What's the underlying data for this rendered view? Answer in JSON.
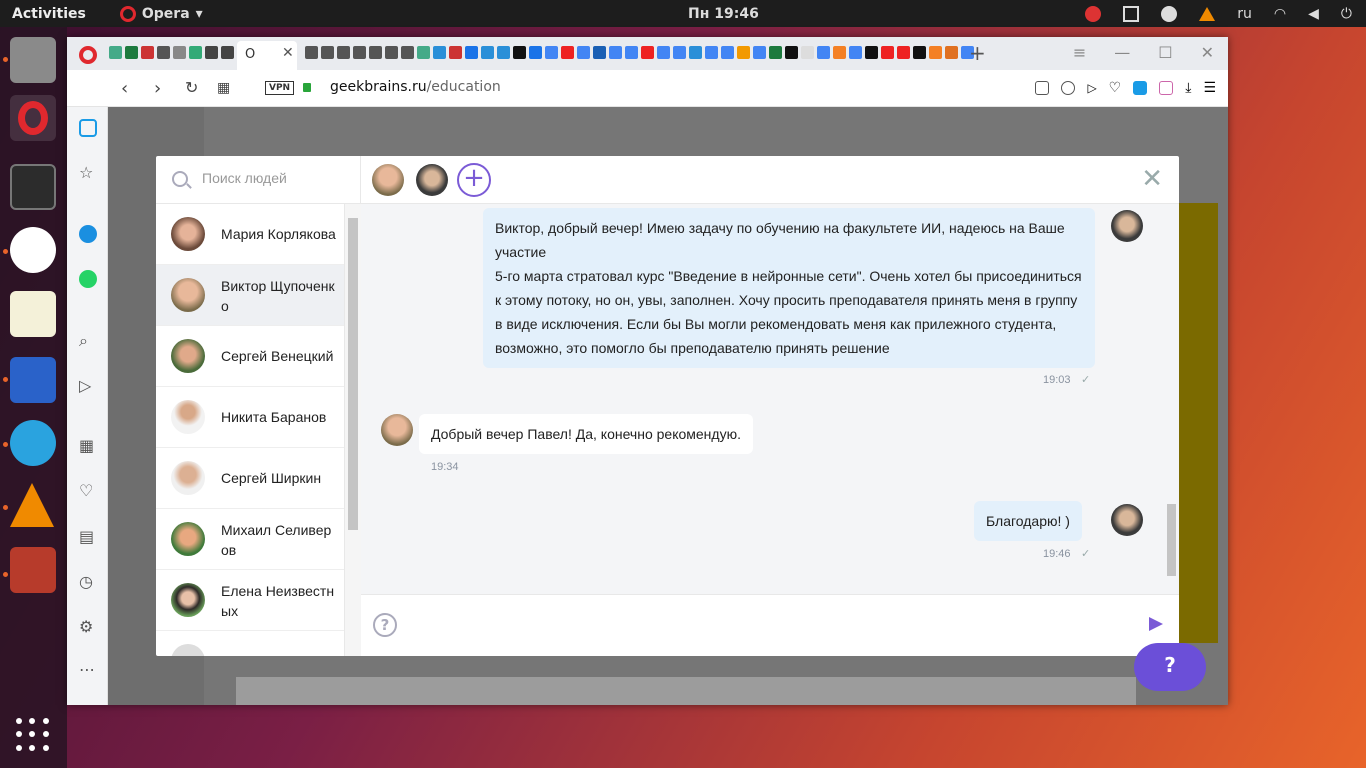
{
  "topbar": {
    "activities": "Activities",
    "app_menu": "Opera",
    "clock": "Пн 19:46",
    "keyboard_layout": "ru"
  },
  "browser": {
    "active_tab_title": "O",
    "url_domain": "geekbrains.ru",
    "url_path": "/education",
    "vpn_label": "VPN"
  },
  "modal": {
    "search_placeholder": "Поиск людей",
    "contacts": [
      {
        "name": "Мария Корлякова"
      },
      {
        "name": "Виктор Щупоченко"
      },
      {
        "name": "Сергей Венецкий"
      },
      {
        "name": "Никита Баранов"
      },
      {
        "name": "Сергей Ширкин"
      },
      {
        "name": "Михаил Селиверов"
      },
      {
        "name": "Елена Неизвестных"
      }
    ],
    "messages": [
      {
        "direction": "out",
        "text": "Виктор, добрый вечер! Имею задачу по обучению на факультете ИИ, надеюсь на Ваше участие\n5-го марта стратовал курс \"Введение в нейронные сети\". Очень хотел бы присоединиться к этому потоку, но он, увы, заполнен. Хочу просить преподавателя принять меня в группу в виде исключения. Если бы Вы могли рекомендовать меня как прилежного студента, возможно, это помогло бы преподавателю принять решение",
        "time": "19:03"
      },
      {
        "direction": "in",
        "text": "Добрый вечер Павел! Да, конечно рекомендую.",
        "time": "19:34"
      },
      {
        "direction": "out",
        "text": "Благодарю! )",
        "time": "19:46"
      }
    ],
    "help_symbol": "?",
    "add_symbol": "+"
  },
  "colors": {
    "accent": "#6b4fd8",
    "bubble_out": "#e3f0fb",
    "lock_green": "#29a53a",
    "opera_red": "#e0282e"
  }
}
